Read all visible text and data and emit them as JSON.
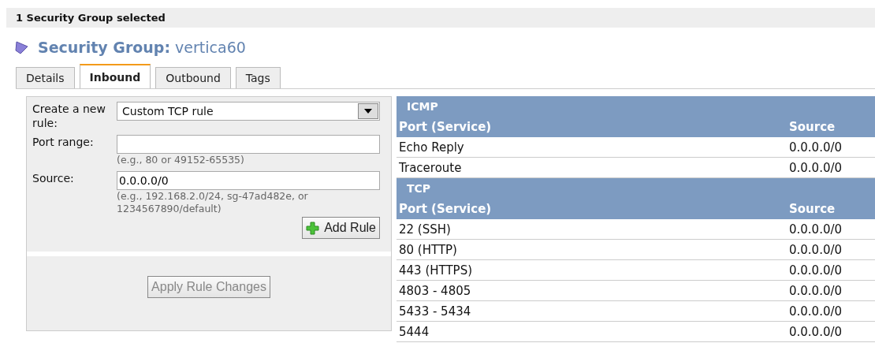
{
  "selection_bar": {
    "text": "1 Security Group selected"
  },
  "heading": {
    "label": "Security Group:",
    "name": "vertica60"
  },
  "tabs": [
    {
      "label": "Details",
      "selected": false
    },
    {
      "label": "Inbound",
      "selected": true
    },
    {
      "label": "Outbound",
      "selected": false
    },
    {
      "label": "Tags",
      "selected": false
    }
  ],
  "rule_form": {
    "create_label": "Create a new rule:",
    "rule_type": "Custom TCP rule",
    "port_label": "Port range:",
    "port_hint": "(e.g., 80 or 49152-65535)",
    "source_label": "Source:",
    "source_value": "0.0.0.0/0",
    "source_hint": "(e.g., 192.168.2.0/24, sg-47ad482e, or 1234567890/default)",
    "add_button": "Add Rule",
    "apply_button": "Apply Rule Changes",
    "apply_disabled": true
  },
  "rule_groups": [
    {
      "protocol": "ICMP",
      "columns": [
        "Port (Service)",
        "Source"
      ],
      "rows": [
        [
          "Echo Reply",
          "0.0.0.0/0"
        ],
        [
          "Traceroute",
          "0.0.0.0/0"
        ]
      ]
    },
    {
      "protocol": "TCP",
      "columns": [
        "Port (Service)",
        "Source"
      ],
      "rows": [
        [
          "22 (SSH)",
          "0.0.0.0/0"
        ],
        [
          "80 (HTTP)",
          "0.0.0.0/0"
        ],
        [
          "443 (HTTPS)",
          "0.0.0.0/0"
        ],
        [
          "4803 - 4805",
          "0.0.0.0/0"
        ],
        [
          "5433 - 5434",
          "0.0.0.0/0"
        ],
        [
          "5444",
          "0.0.0.0/0"
        ]
      ]
    }
  ]
}
